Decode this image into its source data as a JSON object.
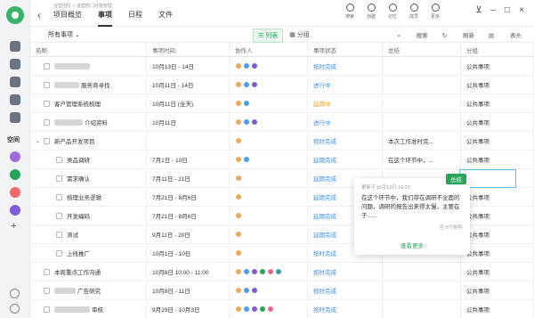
{
  "app": {
    "breadcrumb": "运营团队 > 运营部门月度管理",
    "tabs": [
      {
        "label": "项目概览",
        "active": false
      },
      {
        "label": "事项",
        "active": true
      },
      {
        "label": "日程",
        "active": false
      },
      {
        "label": "文件",
        "active": false
      }
    ],
    "tools": [
      {
        "label": "搜索",
        "icon": "search-icon"
      },
      {
        "label": "创建",
        "icon": "plus-circle-icon"
      },
      {
        "label": "记忆",
        "icon": "memo-icon"
      },
      {
        "label": "成员",
        "icon": "members-icon"
      },
      {
        "label": "更多",
        "icon": "more-icon"
      }
    ]
  },
  "rail": {
    "space_label": "空间",
    "colors": {
      "brand": "#38b56a",
      "space1": "#9b6bdc",
      "space2": "#27a35a",
      "space3": "#f06a6a",
      "space4": "#7b5cd6"
    }
  },
  "toolbar": {
    "filter_label": "所有事项",
    "view_list": "列表",
    "view_group": "分组",
    "search": "搜索",
    "refresh": "刷新",
    "table": "表头"
  },
  "table": {
    "columns": [
      "名称",
      "事项时间",
      "协作人",
      "事项状态",
      "总结",
      "分组"
    ],
    "rows": [
      {
        "name": "",
        "time": "10月13日 - 14日",
        "avatars": 3,
        "status": "按时完成",
        "status_type": "done",
        "summary": "",
        "group": "公共事项",
        "blur_w": 40,
        "level": 0
      },
      {
        "name": "服务商寻找",
        "time": "10月11日 - 14日",
        "avatars": 3,
        "status": "进行中",
        "status_type": "prog",
        "summary": "",
        "group": "公共事项",
        "blur_w": 28,
        "level": 0
      },
      {
        "name": "客户管理系统梳理",
        "time": "10月11日 (全天)",
        "avatars": 2,
        "status": "延期中",
        "status_type": "delay",
        "summary": "",
        "group": "公共事项",
        "blur_w": 0,
        "level": 0
      },
      {
        "name": "介绍资料",
        "time": "10月11日",
        "avatars": 3,
        "status": "进行中",
        "status_type": "prog",
        "summary": "",
        "group": "公共事项",
        "blur_w": 32,
        "level": 0
      },
      {
        "name": "新产品开发项目",
        "time": "",
        "avatars": 1,
        "status": "按时完成",
        "status_type": "done",
        "summary": "本次工作准时完...",
        "group": "公共事项",
        "blur_w": 0,
        "level": 0,
        "expand": true
      },
      {
        "name": "类品调研",
        "time": "7月1日 - 10日",
        "avatars": 2,
        "status": "延期完成",
        "status_type": "done",
        "summary": "在这个环节中，...",
        "group": "公共事项",
        "blur_w": 0,
        "level": 1
      },
      {
        "name": "需求确认",
        "time": "7月11日 - 21日",
        "avatars": 1,
        "status": "延期完成",
        "status_type": "done",
        "summary": "",
        "group": "公共事项",
        "blur_w": 0,
        "level": 1
      },
      {
        "name": "梳理业务逻辑",
        "time": "7月21日 - 8月6日",
        "avatars": 1,
        "status": "延期完成",
        "status_type": "done",
        "summary": "",
        "group": "公共事项",
        "blur_w": 0,
        "level": 1
      },
      {
        "name": "开发编码",
        "time": "7月21日 - 8月6日",
        "avatars": 1,
        "status": "延期完成",
        "status_type": "done",
        "summary": "",
        "group": "公共事项",
        "blur_w": 0,
        "level": 1
      },
      {
        "name": "测试",
        "time": "9月11日 - 20日",
        "avatars": 1,
        "status": "延期完成",
        "status_type": "done",
        "summary": "",
        "group": "公共事项",
        "blur_w": 0,
        "level": 1
      },
      {
        "name": "上线推广",
        "time": "10月1日 - 10日",
        "avatars": 1,
        "status": "按时完成",
        "status_type": "done",
        "summary": "",
        "group": "公共事项",
        "blur_w": 0,
        "level": 1
      },
      {
        "name": "本周重点工作沟通",
        "time": "10月8日 10:00 - 11:00",
        "avatars": 6,
        "status": "按时完成",
        "status_type": "done",
        "summary": "",
        "group": "公共事项",
        "blur_w": 0,
        "level": 0
      },
      {
        "name": "广告研究",
        "time": "10月8日 - 11日",
        "avatars": 3,
        "status": "按时完成",
        "status_type": "done",
        "summary": "",
        "group": "公共事项",
        "blur_w": 24,
        "level": 0
      },
      {
        "name": "审核",
        "time": "9月29日 - 10月3日",
        "avatars": 5,
        "status": "按时完成",
        "status_type": "done",
        "summary": "",
        "group": "公共事项",
        "blur_w": 40,
        "level": 0
      }
    ]
  },
  "popover": {
    "tag": "总结",
    "meta": "更新于10月13日 16:21",
    "body": "在这个环节中，我们存在调研不全面的问题，调研的报告出来得太慢，主要在于......",
    "attachments": "0个附件",
    "more": "查看更多"
  }
}
